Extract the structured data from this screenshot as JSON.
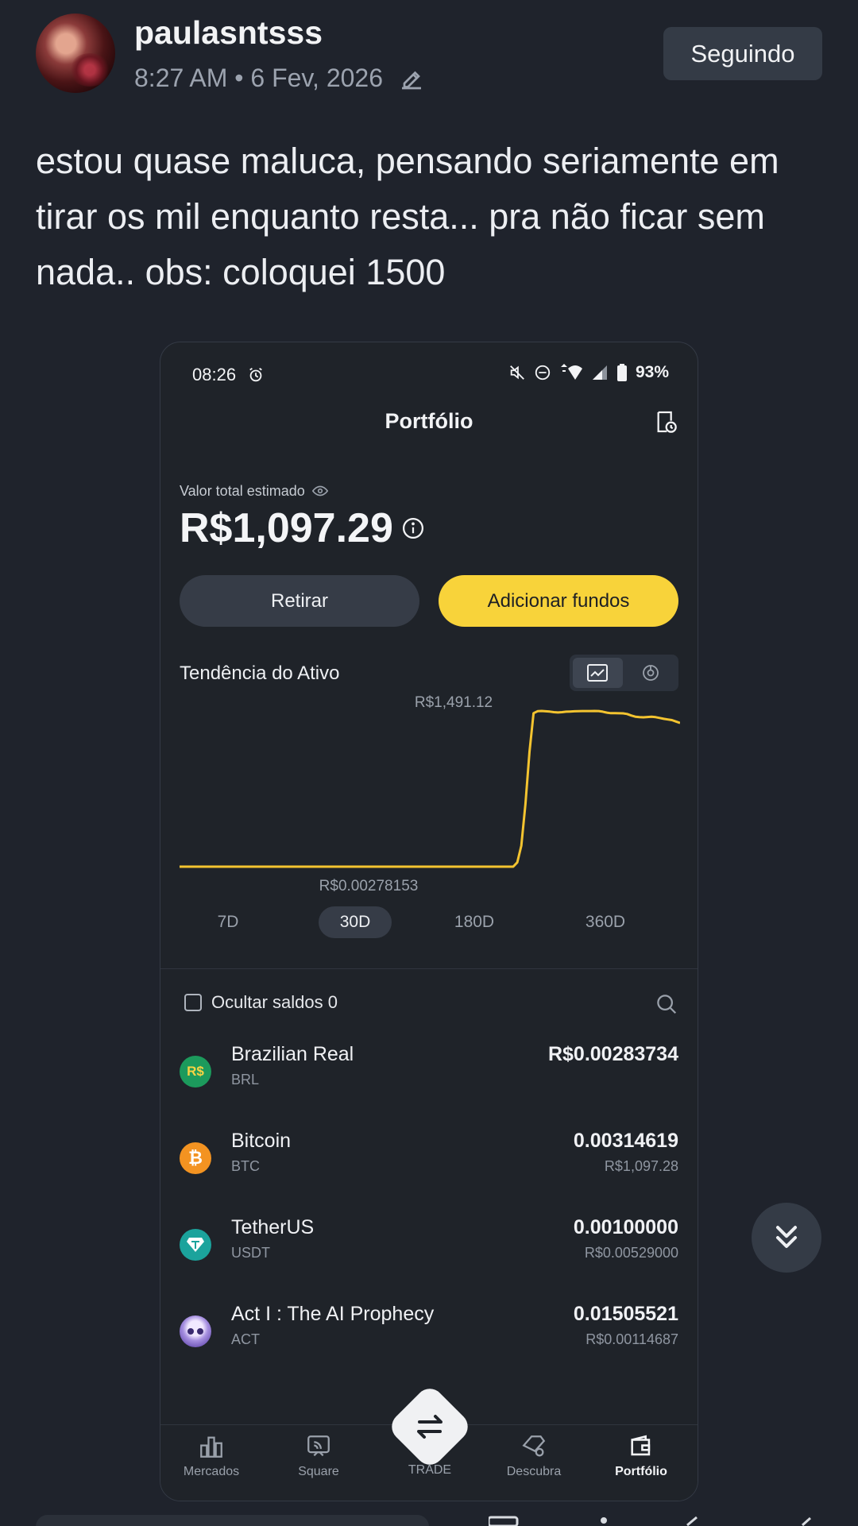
{
  "post": {
    "username": "paulasntsss",
    "meta": "8:27 AM • 6 Fev, 2026",
    "follow_label": "Seguindo",
    "text": "estou quase maluca, pensando seriamente em tirar os mil enquanto resta... pra não ficar sem nada.. obs: coloquei 1500"
  },
  "app": {
    "status": {
      "time": "08:26",
      "battery": "93%"
    },
    "title": "Portfólio",
    "balance_label": "Valor total estimado",
    "balance": "R$1,097.29",
    "withdraw_label": "Retirar",
    "add_funds_label": "Adicionar fundos",
    "trend_title": "Tendência do Ativo",
    "timeframes": [
      "7D",
      "30D",
      "180D",
      "360D"
    ],
    "active_timeframe": "30D",
    "hide_balances_label": "Ocultar saldos 0",
    "assets": [
      {
        "name": "Brazilian Real",
        "symbol": "BRL",
        "amount": "R$0.00283734",
        "fiat": "",
        "icon_text": "R$",
        "color": "#1c9a5c"
      },
      {
        "name": "Bitcoin",
        "symbol": "BTC",
        "amount": "0.00314619",
        "fiat": "R$1,097.28",
        "icon_text": "₿",
        "color": "#f39321"
      },
      {
        "name": "TetherUS",
        "symbol": "USDT",
        "amount": "0.00100000",
        "fiat": "R$0.00529000",
        "icon_text": "",
        "color": "#1ba39c"
      },
      {
        "name": "Act I : The AI Prophecy",
        "symbol": "ACT",
        "amount": "0.01505521",
        "fiat": "R$0.00114687",
        "icon_text": "",
        "color": "#b9a3e0"
      }
    ],
    "nav": [
      {
        "label": "Mercados",
        "icon": "bar-chart-icon"
      },
      {
        "label": "Square",
        "icon": "cast-icon"
      },
      {
        "label": "TRADE",
        "icon": "swap-icon"
      },
      {
        "label": "Descubra",
        "icon": "tag-icon"
      },
      {
        "label": "Portfólio",
        "icon": "wallet-icon"
      }
    ],
    "active_nav": "Portfólio"
  },
  "chart_data": {
    "type": "line",
    "title": "Tendência do Ativo",
    "annotations": {
      "max": "R$1,491.12",
      "min": "R$0.00278153"
    },
    "max_value": 1491.12,
    "min_value": 0.00278153,
    "series": [
      {
        "values": [
          0.00278153,
          0.00278153,
          0.00278153,
          0.00278153,
          0.00278153,
          0.00278153,
          0.00278153,
          0.00278153,
          0.00278153,
          0.00278153,
          0.00278153,
          0.00278153,
          0.00278153,
          0.00278153,
          0.00278153,
          0.00278153,
          0.00278153,
          0.00278153,
          0.00278153,
          0.00278153,
          0.00278153,
          0.00278153,
          0.00278153,
          0.00278153,
          0.00278153,
          0.00278153,
          0.00278153,
          0.00278153,
          0.00278153,
          0.00278153,
          0.00278153,
          0.00278153,
          0.00278153,
          0.00278153,
          0.00278153,
          0.00278153,
          0.00278153,
          0.00278153,
          0.00278153,
          0.00278153,
          0.00278153,
          0.00278153,
          0.00278153,
          0.00278153,
          0.00278153,
          0.00278153,
          0.00278153,
          0.00278153,
          0.00278153,
          0.00278153,
          0.00278153,
          0.00278153,
          0.00278153,
          0.00278153,
          0.00278153,
          0.00278153,
          0.00278153,
          0.00278153,
          0.00278153,
          0.00278153,
          0.00278153,
          0.00278153,
          0.00278153,
          0.00278153,
          0.00278153,
          0.00278153,
          0.00278153,
          0.00278153,
          0.00278153,
          0.00278153,
          0.00278153,
          0.00278153,
          0.00278153,
          0.00278153,
          0.00278153,
          0.00278153,
          0.00278153,
          0.00278153,
          0.00278153,
          0.00278153,
          0.00278153,
          0.00278153,
          0.00278153,
          40,
          200,
          600,
          1100,
          1470,
          1489,
          1491.12,
          1488,
          1485,
          1480,
          1477,
          1480,
          1484,
          1486,
          1488,
          1489,
          1490,
          1490,
          1490,
          1491,
          1490,
          1484,
          1475,
          1470,
          1470,
          1469,
          1468,
          1462,
          1448,
          1436,
          1432,
          1430,
          1433,
          1436,
          1432,
          1424,
          1416,
          1410,
          1404,
          1390,
          1376
        ]
      }
    ],
    "x_range": [
      "7D",
      "30D",
      "180D",
      "360D"
    ]
  }
}
